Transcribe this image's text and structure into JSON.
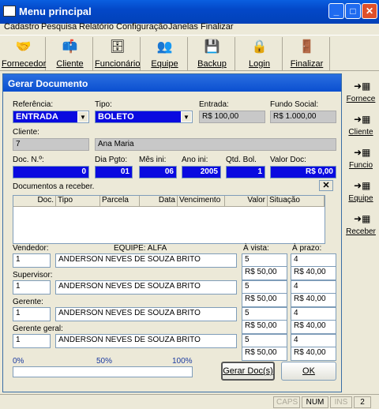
{
  "window": {
    "title": "Menu principal"
  },
  "menu": [
    "Cadastro",
    "Pesquisa",
    "Relatório",
    "Configuração",
    "Janelas",
    "Finalizar"
  ],
  "toolbar": [
    {
      "label": "Fornecedor",
      "icon": "handshake-icon"
    },
    {
      "label": "Cliente",
      "icon": "mailbox-icon"
    },
    {
      "label": "Funcionário",
      "icon": "cabinet-icon"
    },
    {
      "label": "Equipe",
      "icon": "team-icon"
    },
    {
      "label": "Backup",
      "icon": "floppy-icon"
    },
    {
      "label": "Login",
      "icon": "lock-icon"
    },
    {
      "label": "Finalizar",
      "icon": "exit-icon"
    }
  ],
  "sidebar": [
    {
      "label": "Fornece",
      "icon": "arrow-grid-icon"
    },
    {
      "label": "Cliente",
      "icon": "arrow-grid-icon"
    },
    {
      "label": "Funcio",
      "icon": "arrow-grid-icon"
    },
    {
      "label": "Equipe",
      "icon": "arrow-grid-icon"
    },
    {
      "label": "Receber",
      "icon": "arrow-grid-icon"
    }
  ],
  "doc": {
    "title": "Gerar Documento",
    "referencia_label": "Referência:",
    "referencia": "ENTRADA",
    "tipo_label": "Tipo:",
    "tipo": "BOLETO",
    "entrada_label": "Entrada:",
    "entrada": "R$ 100,00",
    "fundo_label": "Fundo Social:",
    "fundo": "R$ 1.000,00",
    "cliente_label": "Cliente:",
    "cliente_id": "7",
    "cliente_nome": "Ana Maria",
    "docn_label": "Doc. N.º:",
    "docn": "0",
    "dia_label": "Dia Pgto:",
    "dia": "01",
    "mes_label": "Mês ini:",
    "mes": "06",
    "ano_label": "Ano ini:",
    "ano": "2005",
    "qtd_label": "Qtd. Bol.",
    "qtd": "1",
    "valor_label": "Valor Doc:",
    "valor": "R$ 0,00",
    "receber_label": "Documentos a receber.",
    "grid_headers": [
      "Doc.",
      "Tipo",
      "Parcela",
      "Data",
      "Vencimento",
      "Valor",
      "Situação"
    ],
    "equipe": "EQUIPE:  ALFA",
    "avista_label": "À vista:",
    "aprazo_label": "À prazo:",
    "roles": [
      {
        "label": "Vendedor:",
        "num": "1",
        "name": "ANDERSON  NEVES DE SOUZA BRITO",
        "av_n": "5",
        "av_v": "R$ 50,00",
        "ap_n": "4",
        "ap_v": "R$ 40,00"
      },
      {
        "label": "Supervisor:",
        "num": "1",
        "name": "ANDERSON NEVES DE SOUZA BRITO",
        "av_n": "5",
        "av_v": "R$ 50,00",
        "ap_n": "4",
        "ap_v": "R$ 40,00"
      },
      {
        "label": "Gerente:",
        "num": "1",
        "name": "ANDERSON NEVES DE SOUZA BRITO",
        "av_n": "5",
        "av_v": "R$ 50,00",
        "ap_n": "4",
        "ap_v": "R$ 40,00"
      },
      {
        "label": "Gerente geral:",
        "num": "1",
        "name": "ANDERSON NEVES DE SOUZA BRITO",
        "av_n": "5",
        "av_v": "R$ 50,00",
        "ap_n": "4",
        "ap_v": "R$ 40,00"
      }
    ],
    "progress_labels": [
      "0%",
      "50%",
      "100%"
    ],
    "progress_value": 0,
    "gerar_label": "Gerar Doc(s)",
    "ok_label": "OK"
  },
  "status": {
    "caps": "CAPS",
    "num": "NUM",
    "ins": "INS",
    "count": "2"
  },
  "colors": {
    "title_blue": "#0348c8",
    "field_blue": "#0a0ae0",
    "progress_label": "#1a3aa0"
  }
}
